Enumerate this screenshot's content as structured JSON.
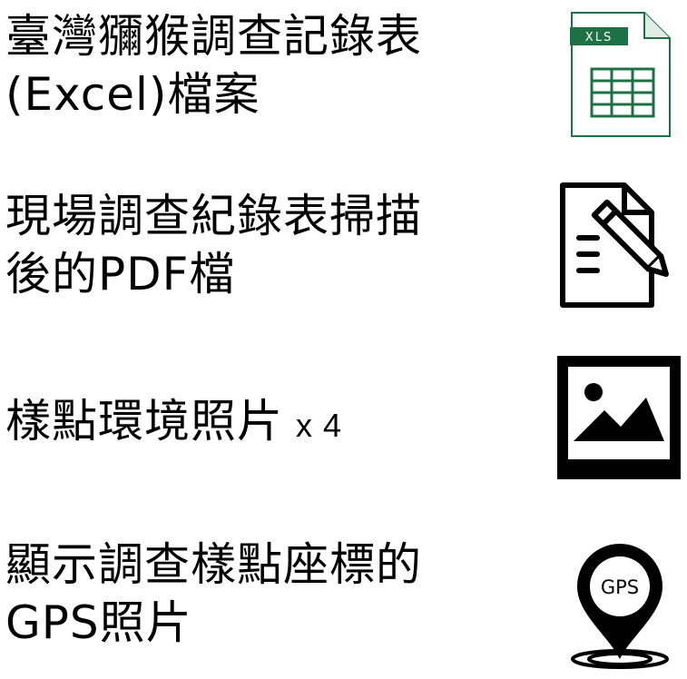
{
  "items": [
    {
      "lines": [
        "臺灣獼猴調查記錄表",
        "(Excel)檔案"
      ],
      "icon": "excel-file-icon",
      "icon_label": "XLS"
    },
    {
      "lines": [
        "現場調查紀錄表掃描",
        "後的PDF檔"
      ],
      "icon": "document-edit-icon"
    },
    {
      "lines": [
        "樣點環境照片"
      ],
      "suffix": "x 4",
      "icon": "photo-icon"
    },
    {
      "lines": [
        "顯示調查樣點座標的",
        "GPS照片"
      ],
      "icon": "gps-pin-icon",
      "icon_label": "GPS"
    }
  ],
  "colors": {
    "excel_green": "#1e7145",
    "excel_light": "#e6f2ea",
    "text": "#000000"
  }
}
